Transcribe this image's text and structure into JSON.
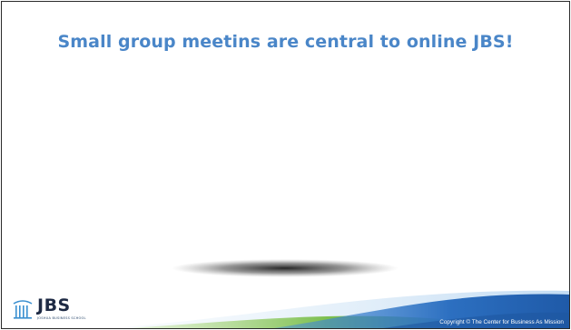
{
  "slide": {
    "title": "Small group meetins are central to online JBS!",
    "footer": {
      "logo_text": "JBS",
      "logo_subtext": "JOSHUA BUSINESS SCHOOL",
      "copyright": "Copyright © The Center for Business As Mission"
    }
  },
  "colors": {
    "title": "#4a86c8",
    "logo_text": "#1e2a44",
    "footer_blue": "#2c6fc0",
    "footer_green": "#7cbf4e",
    "frame": "#2a2a2a"
  },
  "icons": {
    "logo_mark": "pillars-arch-icon"
  }
}
